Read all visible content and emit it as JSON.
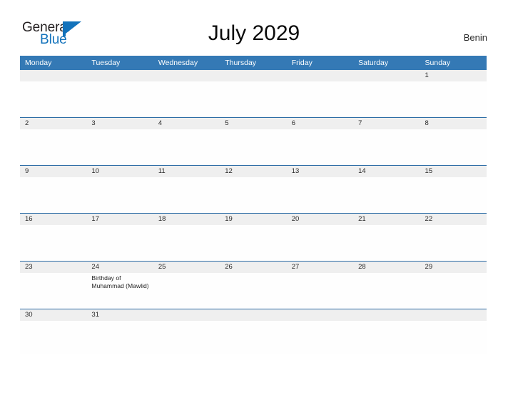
{
  "brand": {
    "name_part1": "General",
    "name_part2": "Blue",
    "flag_icon": "flag-triangle-icon",
    "accent_color": "#1272bb"
  },
  "header": {
    "title": "July 2029",
    "country": "Benin"
  },
  "theme": {
    "header_blue": "#3479b5",
    "row_rule_blue": "#2c6ca5",
    "date_strip_gray": "#efefef",
    "cell_white": "#fefefe",
    "text_dark": "#2a2a2a"
  },
  "calendar": {
    "weekdays": [
      "Monday",
      "Tuesday",
      "Wednesday",
      "Thursday",
      "Friday",
      "Saturday",
      "Sunday"
    ],
    "weeks": [
      {
        "days": [
          {
            "num": "",
            "events": []
          },
          {
            "num": "",
            "events": []
          },
          {
            "num": "",
            "events": []
          },
          {
            "num": "",
            "events": []
          },
          {
            "num": "",
            "events": []
          },
          {
            "num": "",
            "events": []
          },
          {
            "num": "1",
            "events": []
          }
        ]
      },
      {
        "days": [
          {
            "num": "2",
            "events": []
          },
          {
            "num": "3",
            "events": []
          },
          {
            "num": "4",
            "events": []
          },
          {
            "num": "5",
            "events": []
          },
          {
            "num": "6",
            "events": []
          },
          {
            "num": "7",
            "events": []
          },
          {
            "num": "8",
            "events": []
          }
        ]
      },
      {
        "days": [
          {
            "num": "9",
            "events": []
          },
          {
            "num": "10",
            "events": []
          },
          {
            "num": "11",
            "events": []
          },
          {
            "num": "12",
            "events": []
          },
          {
            "num": "13",
            "events": []
          },
          {
            "num": "14",
            "events": []
          },
          {
            "num": "15",
            "events": []
          }
        ]
      },
      {
        "days": [
          {
            "num": "16",
            "events": []
          },
          {
            "num": "17",
            "events": []
          },
          {
            "num": "18",
            "events": []
          },
          {
            "num": "19",
            "events": []
          },
          {
            "num": "20",
            "events": []
          },
          {
            "num": "21",
            "events": []
          },
          {
            "num": "22",
            "events": []
          }
        ]
      },
      {
        "days": [
          {
            "num": "23",
            "events": []
          },
          {
            "num": "24",
            "events": [
              "Birthday of Muhammad (Mawlid)"
            ]
          },
          {
            "num": "25",
            "events": []
          },
          {
            "num": "26",
            "events": []
          },
          {
            "num": "27",
            "events": []
          },
          {
            "num": "28",
            "events": []
          },
          {
            "num": "29",
            "events": []
          }
        ]
      },
      {
        "days": [
          {
            "num": "30",
            "events": []
          },
          {
            "num": "31",
            "events": []
          },
          {
            "num": "",
            "events": []
          },
          {
            "num": "",
            "events": []
          },
          {
            "num": "",
            "events": []
          },
          {
            "num": "",
            "events": []
          },
          {
            "num": "",
            "events": []
          }
        ]
      }
    ]
  }
}
